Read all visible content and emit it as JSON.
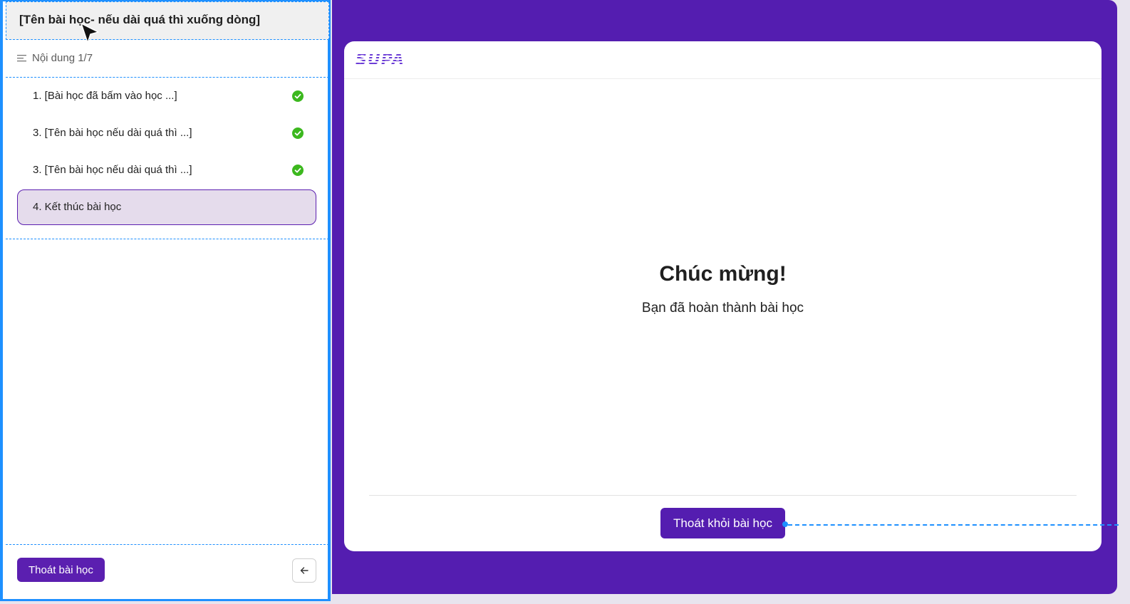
{
  "sidebar": {
    "title": "[Tên bài học- nếu dài quá thì xuống dòng]",
    "progress_label": "Nội dung 1/7",
    "lessons": [
      {
        "label": "1. [Bài học đã bấm vào học ...]",
        "completed": true
      },
      {
        "label": "3. [Tên bài học nếu dài quá thì ...]",
        "completed": true
      },
      {
        "label": "3. [Tên bài học nếu dài quá thì ...]",
        "completed": true
      },
      {
        "label": "4. Kết thúc bài học",
        "completed": false,
        "active": true
      }
    ],
    "exit_label": "Thoát bài học",
    "back_icon": "arrow-left-icon"
  },
  "main": {
    "logo_text": "SUPA",
    "heading": "Chúc mừng!",
    "subtext": "Bạn đã hoàn thành bài học",
    "leave_label": "Thoát khỏi bài học"
  },
  "colors": {
    "brand": "#541db0",
    "success": "#3cb81e",
    "active_bg": "#e5dcec",
    "selection": "#1e90ff"
  }
}
